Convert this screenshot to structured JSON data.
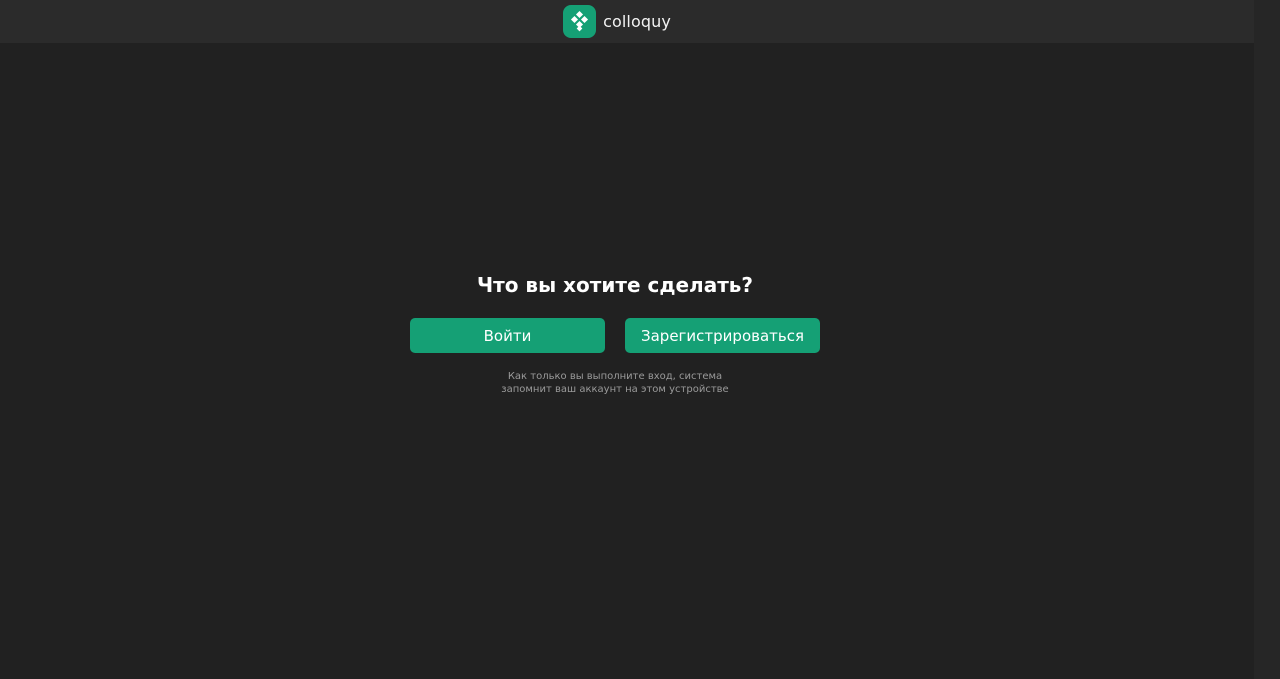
{
  "colors": {
    "background": "#212121",
    "topbar": "#2b2b2b",
    "accent": "#15a075",
    "title_text": "#ffffff",
    "note_text": "#9a9a9a"
  },
  "header": {
    "logo_icon": "diamond-grid-logo-icon",
    "brand_name": "colloquy"
  },
  "main": {
    "title": "Что вы хотите сделать?",
    "login_button": "Войти",
    "register_button": "Зарегистрироваться",
    "note_line1": "Как только вы выполните вход, система",
    "note_line2": "запомнит ваш аккаунт на этом устройстве"
  }
}
